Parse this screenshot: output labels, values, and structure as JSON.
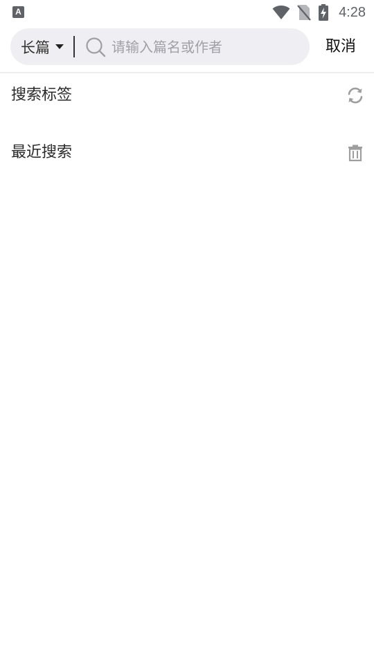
{
  "status_bar": {
    "left_icon": "A",
    "time": "4:28",
    "icons": [
      "wifi-icon",
      "no-sim-icon",
      "battery-charging-icon"
    ]
  },
  "search": {
    "category": "长篇",
    "placeholder": "请输入篇名或作者",
    "value": "",
    "cancel_label": "取消"
  },
  "sections": {
    "tags_title": "搜索标签",
    "tags_action_icon": "refresh-icon",
    "recent_title": "最近搜索",
    "recent_action_icon": "trash-icon"
  },
  "colors": {
    "search_bg": "#efeff3",
    "icon_gray": "#9e9e9e",
    "status_gray": "#5f6368"
  }
}
